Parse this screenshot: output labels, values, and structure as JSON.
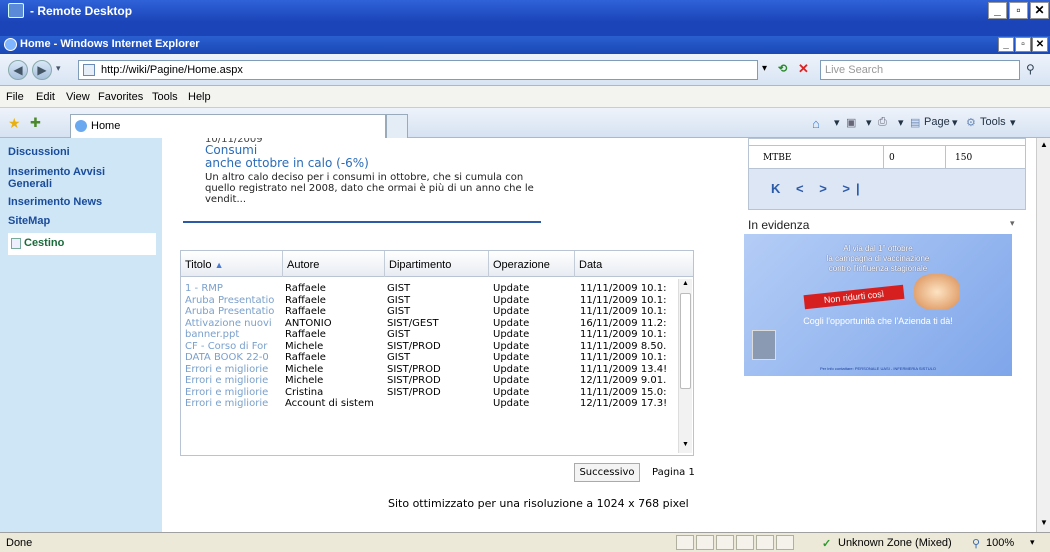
{
  "rdp": {
    "title": "- Remote Desktop"
  },
  "ie": {
    "title": "Home - Windows Internet Explorer"
  },
  "address": {
    "url": "http://wiki/Pagine/Home.aspx",
    "search_placeholder": "Live Search"
  },
  "menu": [
    "File",
    "Edit",
    "View",
    "Favorites",
    "Tools",
    "Help"
  ],
  "tab": {
    "label": "Home"
  },
  "commands": {
    "page": "Page",
    "tools": "Tools"
  },
  "sidebar": {
    "items": [
      "Discussioni",
      "Inserimento Avvisi Generali",
      "Inserimento News",
      "SiteMap"
    ],
    "bin": "Cestino"
  },
  "news": {
    "date": "10/11/2009",
    "title_line1": "Consumi",
    "title_line2": "anche ottobre in calo (-6%)",
    "text": "Un altro calo deciso per i consumi in ottobre, che si cumula con quello registrato nel 2008, dato che ormai è più di un anno che le vendit..."
  },
  "docs": {
    "columns": [
      "Titolo",
      "Autore",
      "Dipartimento",
      "Operazione",
      "Data"
    ],
    "rows": [
      [
        "1 - RMP",
        "Raffaele",
        "GIST",
        "Update",
        "11/11/2009 10.1:"
      ],
      [
        "Aruba Presentatio",
        "Raffaele",
        "GIST",
        "Update",
        "11/11/2009 10.1:"
      ],
      [
        "Aruba Presentatio",
        "Raffaele",
        "GIST",
        "Update",
        "11/11/2009 10.1:"
      ],
      [
        "Attivazione nuovi",
        "ANTONIO",
        "SIST/GEST",
        "Update",
        "16/11/2009 11.2:"
      ],
      [
        "banner.ppt",
        "Raffaele",
        "GIST",
        "Update",
        "11/11/2009 10.1:"
      ],
      [
        "CF - Corso di For",
        "Michele",
        "SIST/PROD",
        "Update",
        "11/11/2009 8.50."
      ],
      [
        "DATA BOOK 22-0",
        "Raffaele",
        "GIST",
        "Update",
        "11/11/2009 10.1:"
      ],
      [
        "Errori e migliorie",
        "Michele",
        "SIST/PROD",
        "Update",
        "11/11/2009 13.4!"
      ],
      [
        "Errori e migliorie",
        "Michele",
        "SIST/PROD",
        "Update",
        "12/11/2009 9.01."
      ],
      [
        "Errori e migliorie",
        "Cristina",
        "SIST/PROD",
        "Update",
        "11/11/2009 15.0:"
      ],
      [
        "Errori e migliorie",
        "Account di sistem",
        "",
        "Update",
        "12/11/2009 17.3!"
      ]
    ],
    "next_label": "Successivo",
    "page_label": "Pagina 1"
  },
  "footer": "Sito ottimizzato per una risoluzione a 1024 x 768 pixel",
  "right_table": {
    "code": "MTBE",
    "value1": "0",
    "value2": "150",
    "pager": "K < > >|"
  },
  "evidenza": {
    "title": "In evidenza",
    "banner_line1": "Al via dal 1° ottobre",
    "banner_line2": "la campagna di vaccinazione",
    "banner_line3": "contro l'influenza stagionale",
    "banner_red": "Non ridurti così",
    "banner_cta": "Cogli l'opportunità che l'Azienda ti dà!",
    "banner_foot": "Per info contattare: PERSONALE UASI - INFERMERIA SISTULO"
  },
  "status": {
    "left": "Done",
    "zone": "Unknown Zone (Mixed)",
    "zoom": "100%"
  }
}
